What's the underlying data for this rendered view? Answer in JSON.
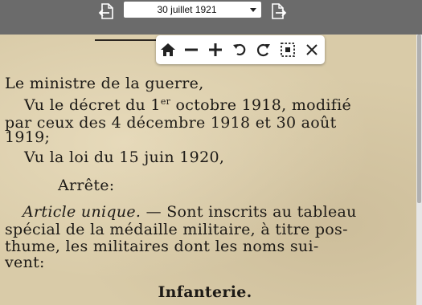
{
  "topbar": {
    "selected_date": "30 juillet 1921",
    "prev_icon": "document-previous-icon",
    "next_icon": "document-next-icon"
  },
  "toolbar": {
    "icons": [
      "home-icon",
      "zoom-out-icon",
      "zoom-in-icon",
      "rotate-left-icon",
      "rotate-right-icon",
      "select-area-icon",
      "close-icon"
    ]
  },
  "document": {
    "line1": "Le ministre de la guerre,",
    "line2_a": "Vu le décret du 1",
    "line2_sup": "er",
    "line2_b": " octobre 1918, modifié",
    "line3": "par ceux des 4 décembre 1918 et 30 août",
    "line4": "1919;",
    "line5": "Vu la loi du 15 juin 1920,",
    "line6": "Arrête:",
    "line7_ital": "Article unique.",
    "line7_rest": " — Sont inscrits au tableau",
    "line8": "spécial de la médaille militaire, à titre pos-",
    "line9": "thume, les militaires dont les noms sui-",
    "line10": "vent:",
    "heading": "Infanterie."
  },
  "colors": {
    "topbar": "#6b6b6b",
    "paper": "#d9cba8",
    "ink": "#1d1a16"
  }
}
